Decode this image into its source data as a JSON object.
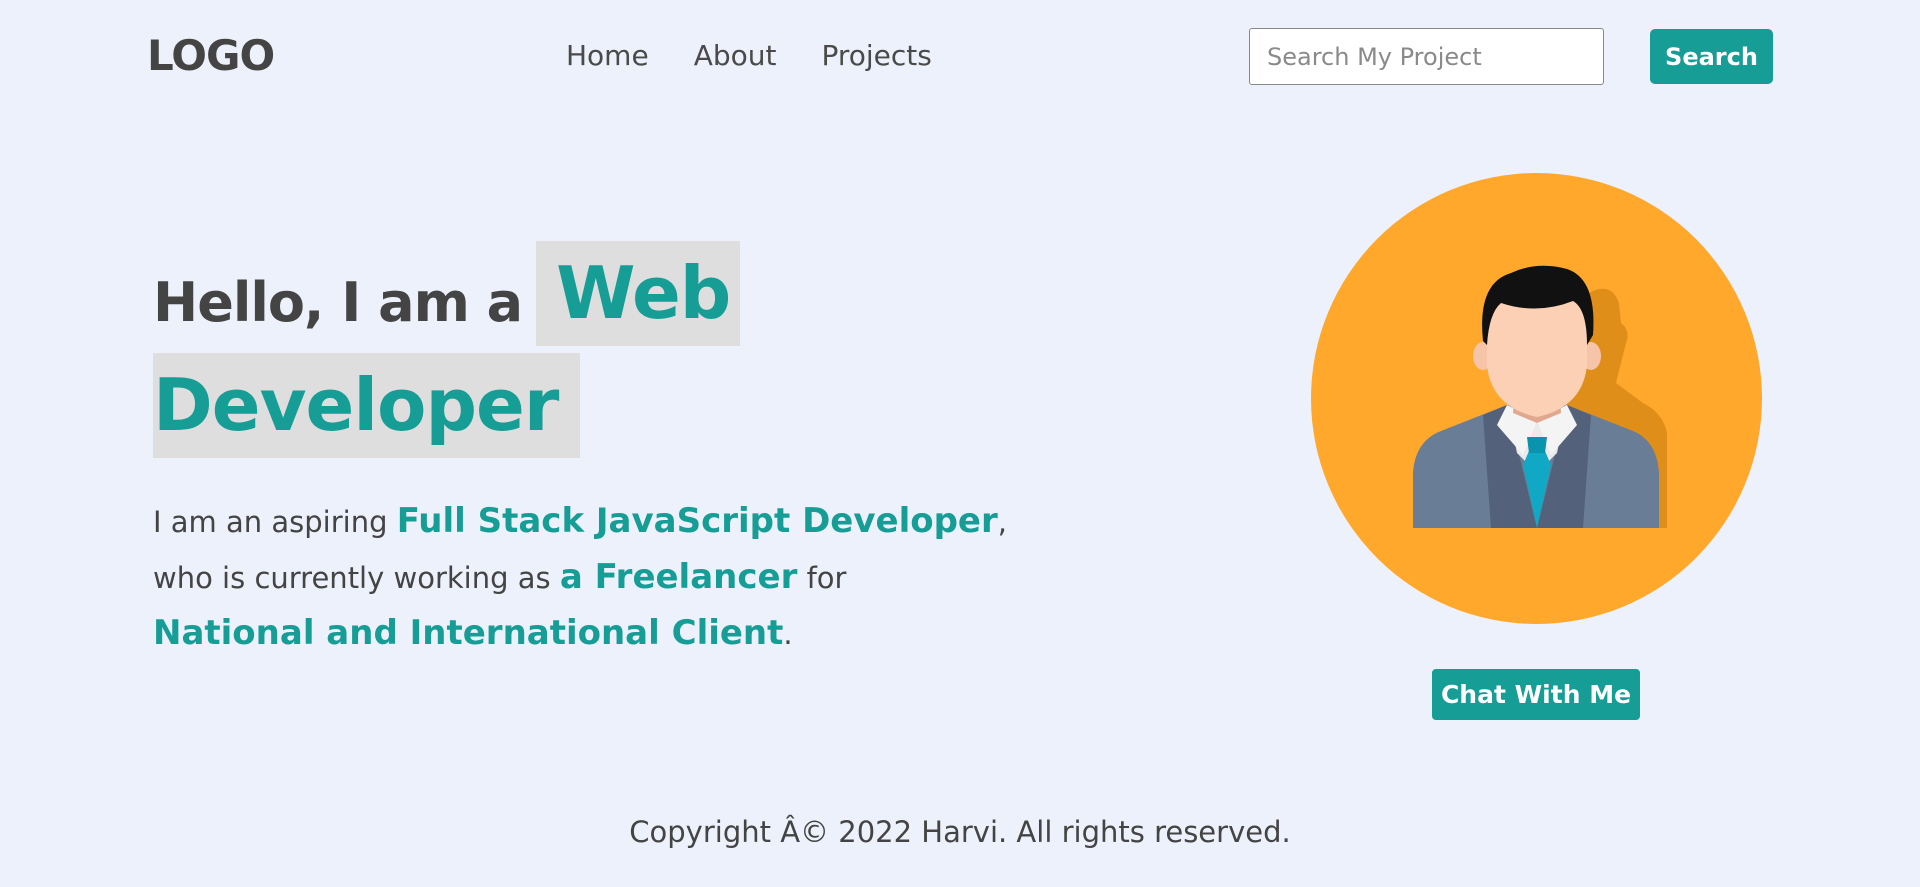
{
  "header": {
    "logo": "LOGO",
    "nav": [
      {
        "label": "Home"
      },
      {
        "label": "About"
      },
      {
        "label": "Projects"
      }
    ],
    "search": {
      "placeholder": "Search My Project",
      "value": ""
    },
    "search_button": "Search"
  },
  "hero": {
    "intro": "Hello, I am a",
    "role_part1": "Web",
    "role_part2": "Developer",
    "desc": {
      "t1": "I am an aspiring ",
      "h1": "Full Stack JavaScript Developer",
      "t2": ",",
      "t3": "who is currently working as ",
      "h2": "a Freelancer",
      "t4": " for",
      "h3": "National and International Client",
      "t5": "."
    }
  },
  "chat_button": "Chat With Me",
  "footer": {
    "copyright": "Copyright Â© 2022 Harvi. All rights reserved."
  },
  "colors": {
    "accent": "#169d96",
    "avatar_bg": "#ffa82b",
    "page_bg": "#edf1fb"
  }
}
